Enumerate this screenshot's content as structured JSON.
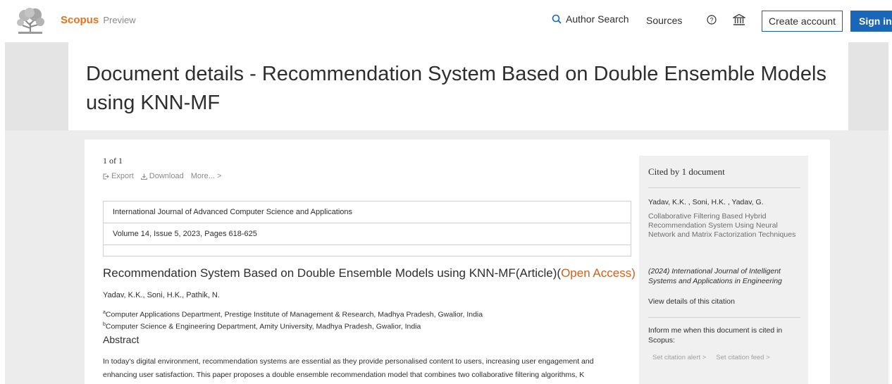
{
  "header": {
    "brand": "Scopus",
    "brand_suffix": "Preview",
    "author_search": "Author Search",
    "sources": "Sources",
    "create_account": "Create account",
    "sign_in": "Sign in"
  },
  "page_title": "Document details - Recommendation System Based on Double Ensemble Models using KNN-MF",
  "doc": {
    "count": "1 of 1",
    "export": "Export",
    "download": "Download",
    "more": "More... >",
    "journal": "International Journal of Advanced Computer Science and Applications",
    "volume": "Volume 14, Issue 5, 2023, Pages 618-625",
    "article_title": "Recommendation System Based on Double Ensemble Models using KNN-MF",
    "article_type": "(Article)",
    "open_access_prefix": "(",
    "open_access": "Open Access)",
    "authors": "Yadav, K.K.,   Soni, H.K.,   Pathik, N.",
    "affil_a_mark": "a",
    "affil_a": "Computer Applications Department, Prestige Institute of Management & Research, Madhya Pradesh, Gwalior, India",
    "affil_b_mark": "b",
    "affil_b": "Computer Science & Engineering Department, Amity University, Madhya Pradesh, Gwalior, India",
    "abstract_heading": "Abstract",
    "abstract_line1": "In today's digital environment, recommendation systems are essential as they provide personalised content to users, increasing user engagement and",
    "abstract_line2": "enhancing user satisfaction. This paper proposes a double ensemble recommendation model that combines two collaborative filtering algorithms, K"
  },
  "cited": {
    "heading": "Cited by 1 document",
    "authors": "Yadav, K.K. , Soni, H.K. , Yadav, G.",
    "title": "Collaborative Filtering Based Hybrid Recommendation System Using Neural Network and Matrix Factorization Techniques",
    "journal": "(2024) International Journal of Intelligent Systems and Applications in Engineering",
    "view_details": "View details of this citation",
    "inform": "Inform me when this document is cited in Scopus:",
    "alert": "Set citation alert >",
    "feed": "Set citation feed >"
  },
  "colors": {
    "brand_orange": "#e9711c",
    "sign_in_blue": "#1a66b8",
    "open_access": "#d15f1a"
  }
}
